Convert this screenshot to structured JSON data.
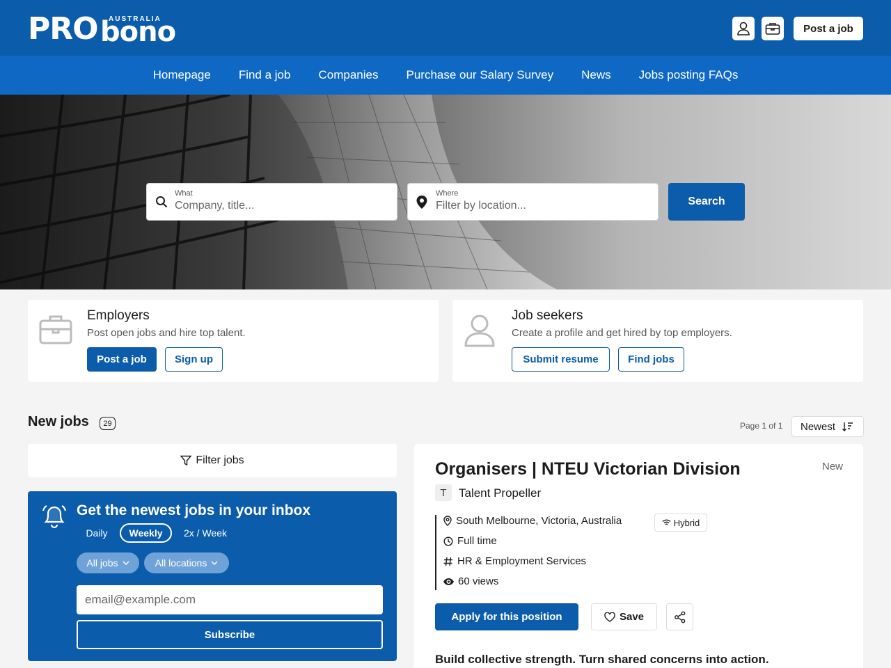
{
  "brand": {
    "pro": "PRO",
    "bono": "bono",
    "country": "AUSTRALIA"
  },
  "header": {
    "post_job": "Post a job"
  },
  "nav": [
    "Homepage",
    "Find a job",
    "Companies",
    "Purchase our Salary Survey",
    "News",
    "Jobs posting FAQs"
  ],
  "search": {
    "what_label": "What",
    "what_placeholder": "Company, title...",
    "where_label": "Where",
    "where_placeholder": "Filter by location...",
    "button": "Search"
  },
  "employers": {
    "title": "Employers",
    "desc": "Post open jobs and hire top talent.",
    "primary": "Post a job",
    "secondary": "Sign up"
  },
  "seekers": {
    "title": "Job seekers",
    "desc": "Create a profile and get hired by top employers.",
    "primary": "Submit resume",
    "secondary": "Find jobs"
  },
  "listing": {
    "title": "New jobs",
    "count": "29",
    "page_info": "Page 1 of 1",
    "sort": "Newest",
    "filter": "Filter jobs"
  },
  "alert": {
    "title": "Get the newest jobs in your inbox",
    "freq": [
      "Daily",
      "Weekly",
      "2x / Week"
    ],
    "filters": [
      "All jobs",
      "All locations"
    ],
    "email_placeholder": "email@example.com",
    "subscribe": "Subscribe"
  },
  "job": {
    "title": "Organisers | NTEU Victorian Division",
    "tag": "New",
    "company_initial": "T",
    "company": "Talent Propeller",
    "location": "South Melbourne, Victoria, Australia",
    "work_mode": "Hybrid",
    "type": "Full time",
    "category": "HR & Employment Services",
    "views": "60 views",
    "apply": "Apply for this position",
    "save": "Save",
    "tagline": "Build collective strength. Turn shared concerns into action."
  },
  "colors": {
    "primary": "#0b5cab",
    "nav": "#0f68c4"
  }
}
